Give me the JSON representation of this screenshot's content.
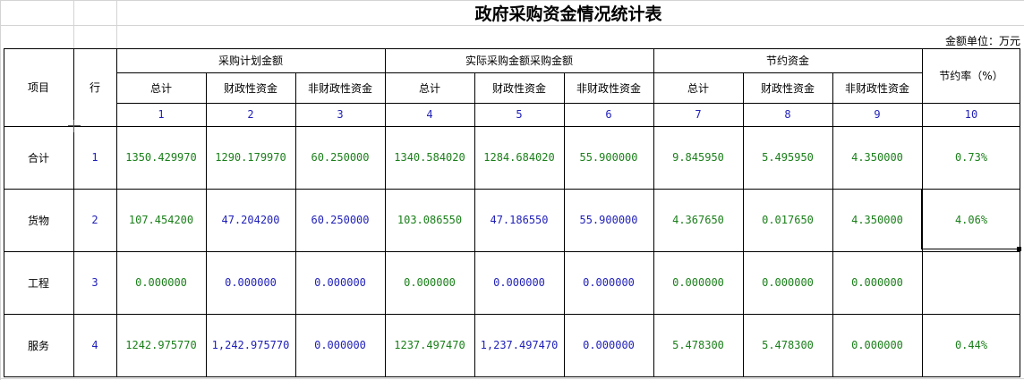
{
  "title": "政府采购资金情况统计表",
  "unit_label": "金额单位：万元",
  "header": {
    "item": "项目",
    "row": "行",
    "groups": [
      "采购计划金额",
      "实际采购金额采购金额",
      "节约资金"
    ],
    "sub": [
      "总计",
      "财政性资金",
      "非财政性资金",
      "总计",
      "财政性资金",
      "非财政性资金",
      "总计",
      "财政性资金",
      "非财政性资金"
    ],
    "rate": "节约率（%）",
    "col_numbers": [
      "1",
      "2",
      "3",
      "4",
      "5",
      "6",
      "7",
      "8",
      "9",
      "10"
    ]
  },
  "rows": [
    {
      "item": "合计",
      "row": "1",
      "values": [
        "1350.429970",
        "1290.179970",
        "60.250000",
        "1340.584020",
        "1284.684020",
        "55.900000",
        "9.845950",
        "5.495950",
        "4.350000",
        "0.73%"
      ]
    },
    {
      "item": "货物",
      "row": "2",
      "values": [
        "107.454200",
        "47.204200",
        "60.250000",
        "103.086550",
        "47.186550",
        "55.900000",
        "4.367650",
        "0.017650",
        "4.350000",
        "4.06%"
      ]
    },
    {
      "item": "工程",
      "row": "3",
      "values": [
        "0.000000",
        "0.000000",
        "0.000000",
        "0.000000",
        "0.000000",
        "0.000000",
        "0.000000",
        "0.000000",
        "0.000000",
        ""
      ]
    },
    {
      "item": "服务",
      "row": "4",
      "values": [
        "1242.975770",
        "1,242.975770",
        "0.000000",
        "1237.497470",
        "1,237.497470",
        "0.000000",
        "5.478300",
        "5.478300",
        "0.000000",
        "0.44%"
      ]
    }
  ],
  "value_colors": [
    [
      "green",
      "green",
      "green",
      "green",
      "green",
      "green",
      "green",
      "green",
      "green",
      "green"
    ],
    [
      "green",
      "blue",
      "blue",
      "green",
      "blue",
      "blue",
      "green",
      "green",
      "green",
      "green"
    ],
    [
      "green",
      "blue",
      "blue",
      "green",
      "blue",
      "blue",
      "green",
      "green",
      "green",
      "green"
    ],
    [
      "green",
      "blue",
      "blue",
      "green",
      "blue",
      "blue",
      "green",
      "green",
      "green",
      "green"
    ]
  ],
  "colors": {
    "green": "#1a7f1a",
    "blue": "#1f1fb8"
  }
}
